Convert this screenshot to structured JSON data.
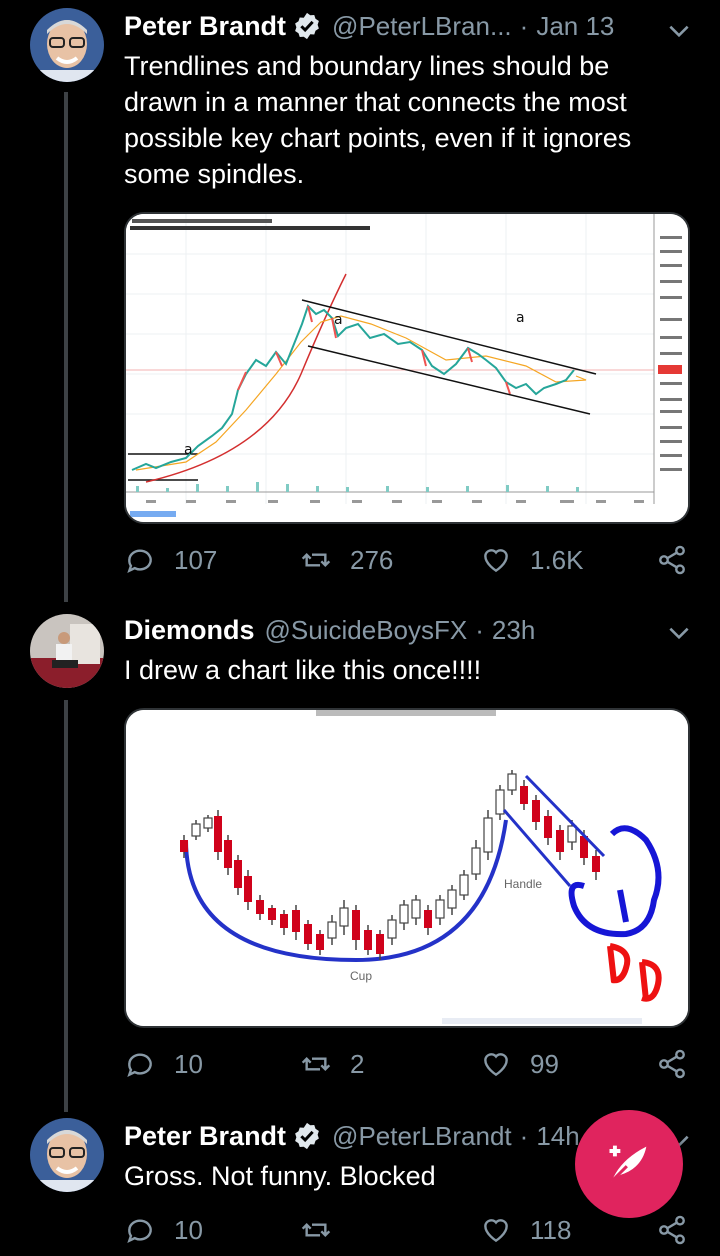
{
  "tweets": [
    {
      "name": "Peter Brandt",
      "handle": "@PeterLBran...",
      "time": "Jan 13",
      "text": "Trendlines and boundary lines should be drawn in a manner that connects the most possible key chart points, even if it ignores some spindles.",
      "media_icon": "btc-chart-image",
      "replies": "107",
      "retweets": "276",
      "likes": "1.6K"
    },
    {
      "name": "Diemonds",
      "handle": "@SuicideBoysFX",
      "time": "23h",
      "text": "I drew a chart like this once!!!!",
      "media_icon": "cup-and-handle-image",
      "media_labels": {
        "cup": "Cup",
        "handle": "Handle"
      },
      "replies": "10",
      "retweets": "2",
      "likes": "99"
    },
    {
      "name": "Peter Brandt",
      "handle": "@PeterLBrandt",
      "time": "14h",
      "text": "Gross. Not funny. Blocked",
      "replies": "10",
      "retweets": "",
      "likes": "118"
    }
  ],
  "colors": {
    "accent": "#1da1f2",
    "muted": "#8899a6",
    "fab": "#e0245e"
  },
  "fab_icon": "compose-tweet-icon"
}
